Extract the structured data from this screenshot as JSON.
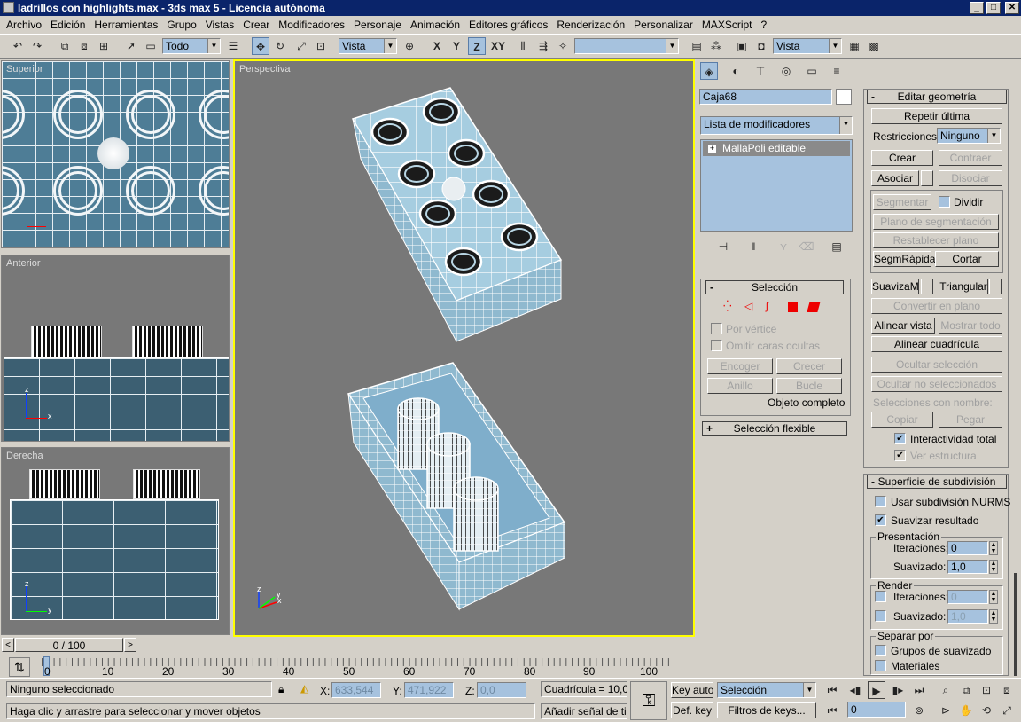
{
  "window": {
    "title": "ladrillos con highlights.max - 3ds max 5 - Licencia autónoma",
    "min": "_",
    "max": "□",
    "close": "✕"
  },
  "menu": [
    "Archivo",
    "Edición",
    "Herramientas",
    "Grupo",
    "Vistas",
    "Crear",
    "Modificadores",
    "Personaje",
    "Animación",
    "Editores gráficos",
    "Renderización",
    "Personalizar",
    "MAXScript",
    "?"
  ],
  "toolbar": {
    "selection_filter": "Todo",
    "ref_coord": "Vista",
    "axis_x": "X",
    "axis_y": "Y",
    "axis_z": "Z",
    "axis_xy": "XY",
    "named_selection": "",
    "render_view": "Vista"
  },
  "viewports": {
    "top": "Superior",
    "front": "Anterior",
    "right": "Derecha",
    "persp": "Perspectiva"
  },
  "axes": {
    "x": "x",
    "y": "y",
    "z": "z"
  },
  "panel": {
    "object_name": "Caja68",
    "modifier_list": "Lista de modificadores",
    "stack_item": "MallaPoli editable",
    "selection": {
      "title": "Selección",
      "by_vertex": "Por vértice",
      "ignore_backfacing": "Omitir caras ocultas",
      "shrink": "Encoger",
      "grow": "Crecer",
      "ring": "Anillo",
      "loop": "Bucle",
      "object_level": "Objeto completo"
    },
    "soft_selection": "Selección flexible"
  },
  "edit_geometry": {
    "title": "Editar geometría",
    "repeat_last": "Repetir última",
    "constraints_label": "Restricciones:",
    "constraints_value": "Ninguno",
    "create": "Crear",
    "collapse": "Contraer",
    "attach": "Asociar",
    "detach": "Disociar",
    "slice_plane": "Segmentar",
    "split": "Dividir",
    "slice_plane_btn": "Plano de segmentación",
    "reset_plane": "Restablecer plano",
    "quickslice": "SegmRápida",
    "cut": "Cortar",
    "meshsmooth": "SuavizaM",
    "tessellate": "Triangular",
    "make_planar": "Convertir en plano",
    "view_align": "Alinear vista",
    "unhide_all": "Mostrar todo",
    "grid_align": "Alinear cuadrícula",
    "hide_selected": "Ocultar selección",
    "hide_unselected": "Ocultar no seleccionados",
    "named_selections": "Selecciones con nombre:",
    "copy": "Copiar",
    "paste": "Pegar",
    "full_interactivity": "Interactividad total",
    "show_cage": "Ver estructura"
  },
  "subdivision": {
    "title": "Superficie de subdivisión",
    "use_nurms": "Usar subdivisión NURMS",
    "smooth_result": "Suavizar resultado",
    "display": "Presentación",
    "iterations": "Iteraciones:",
    "iterations_value": "0",
    "smoothness": "Suavizado:",
    "smoothness_value": "1,0",
    "render": "Render",
    "r_iterations_value": "0",
    "r_smoothness_value": "1,0",
    "separate_by": "Separar por",
    "smoothing_groups": "Grupos de suavizado",
    "materials": "Materiales"
  },
  "timeline": {
    "slider": "0 / 100",
    "ticks": [
      "0",
      "10",
      "20",
      "30",
      "40",
      "50",
      "60",
      "70",
      "80",
      "90",
      "100"
    ],
    "prev": "<",
    "next": ">"
  },
  "status": {
    "selection": "Ninguno seleccionado",
    "prompt": "Haga clic y arrastre para seleccionar y mover objetos",
    "x_label": "X:",
    "x": "633,544",
    "y_label": "Y:",
    "y": "471,922",
    "z_label": "Z:",
    "z": "0,0",
    "grid": "Cuadrícula = 10,0",
    "add_time_tag": "Añadir señal de tiem",
    "key_auto": "Key auto",
    "key_mode": "Selección",
    "def_key": "Def. key",
    "key_filters": "Filtros de keys...",
    "frame": "0"
  },
  "colors": {
    "title_bar": "#0a246a",
    "viewport_bg": "#787878",
    "grid_blue": "#4e7d96",
    "field_blue": "#a6c2de",
    "active_border": "#ffff00"
  }
}
